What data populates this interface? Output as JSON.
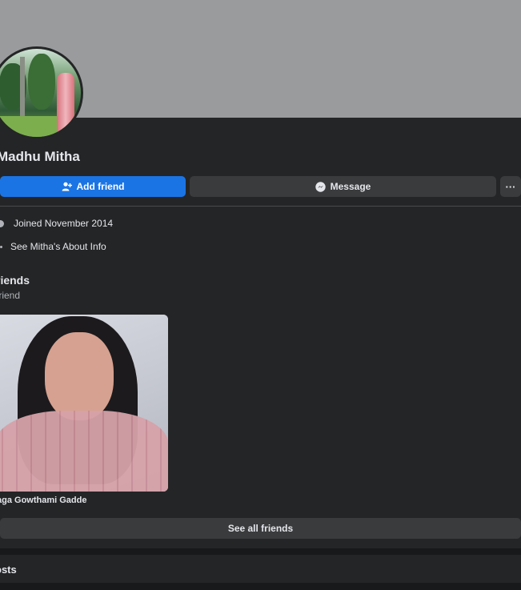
{
  "profile": {
    "name": "Madhu Mitha"
  },
  "actions": {
    "add_friend": "Add friend",
    "message": "Message",
    "more": "···"
  },
  "icons": {
    "add_friend": "add-user-icon",
    "message": "messenger-icon",
    "joined": "clock-icon",
    "about": "info-icon"
  },
  "intro": {
    "joined": "Joined November 2014",
    "about": "See Mitha's About Info"
  },
  "friends": {
    "title": "riends",
    "count": "friend",
    "items": [
      {
        "name": "aga Gowthami Gadde"
      }
    ],
    "see_all": "See all friends"
  },
  "posts": {
    "title": "osts"
  },
  "colors": {
    "accent": "#1b74e4",
    "background": "#242526",
    "cover": "#9a9b9d",
    "button": "#3a3b3c"
  }
}
